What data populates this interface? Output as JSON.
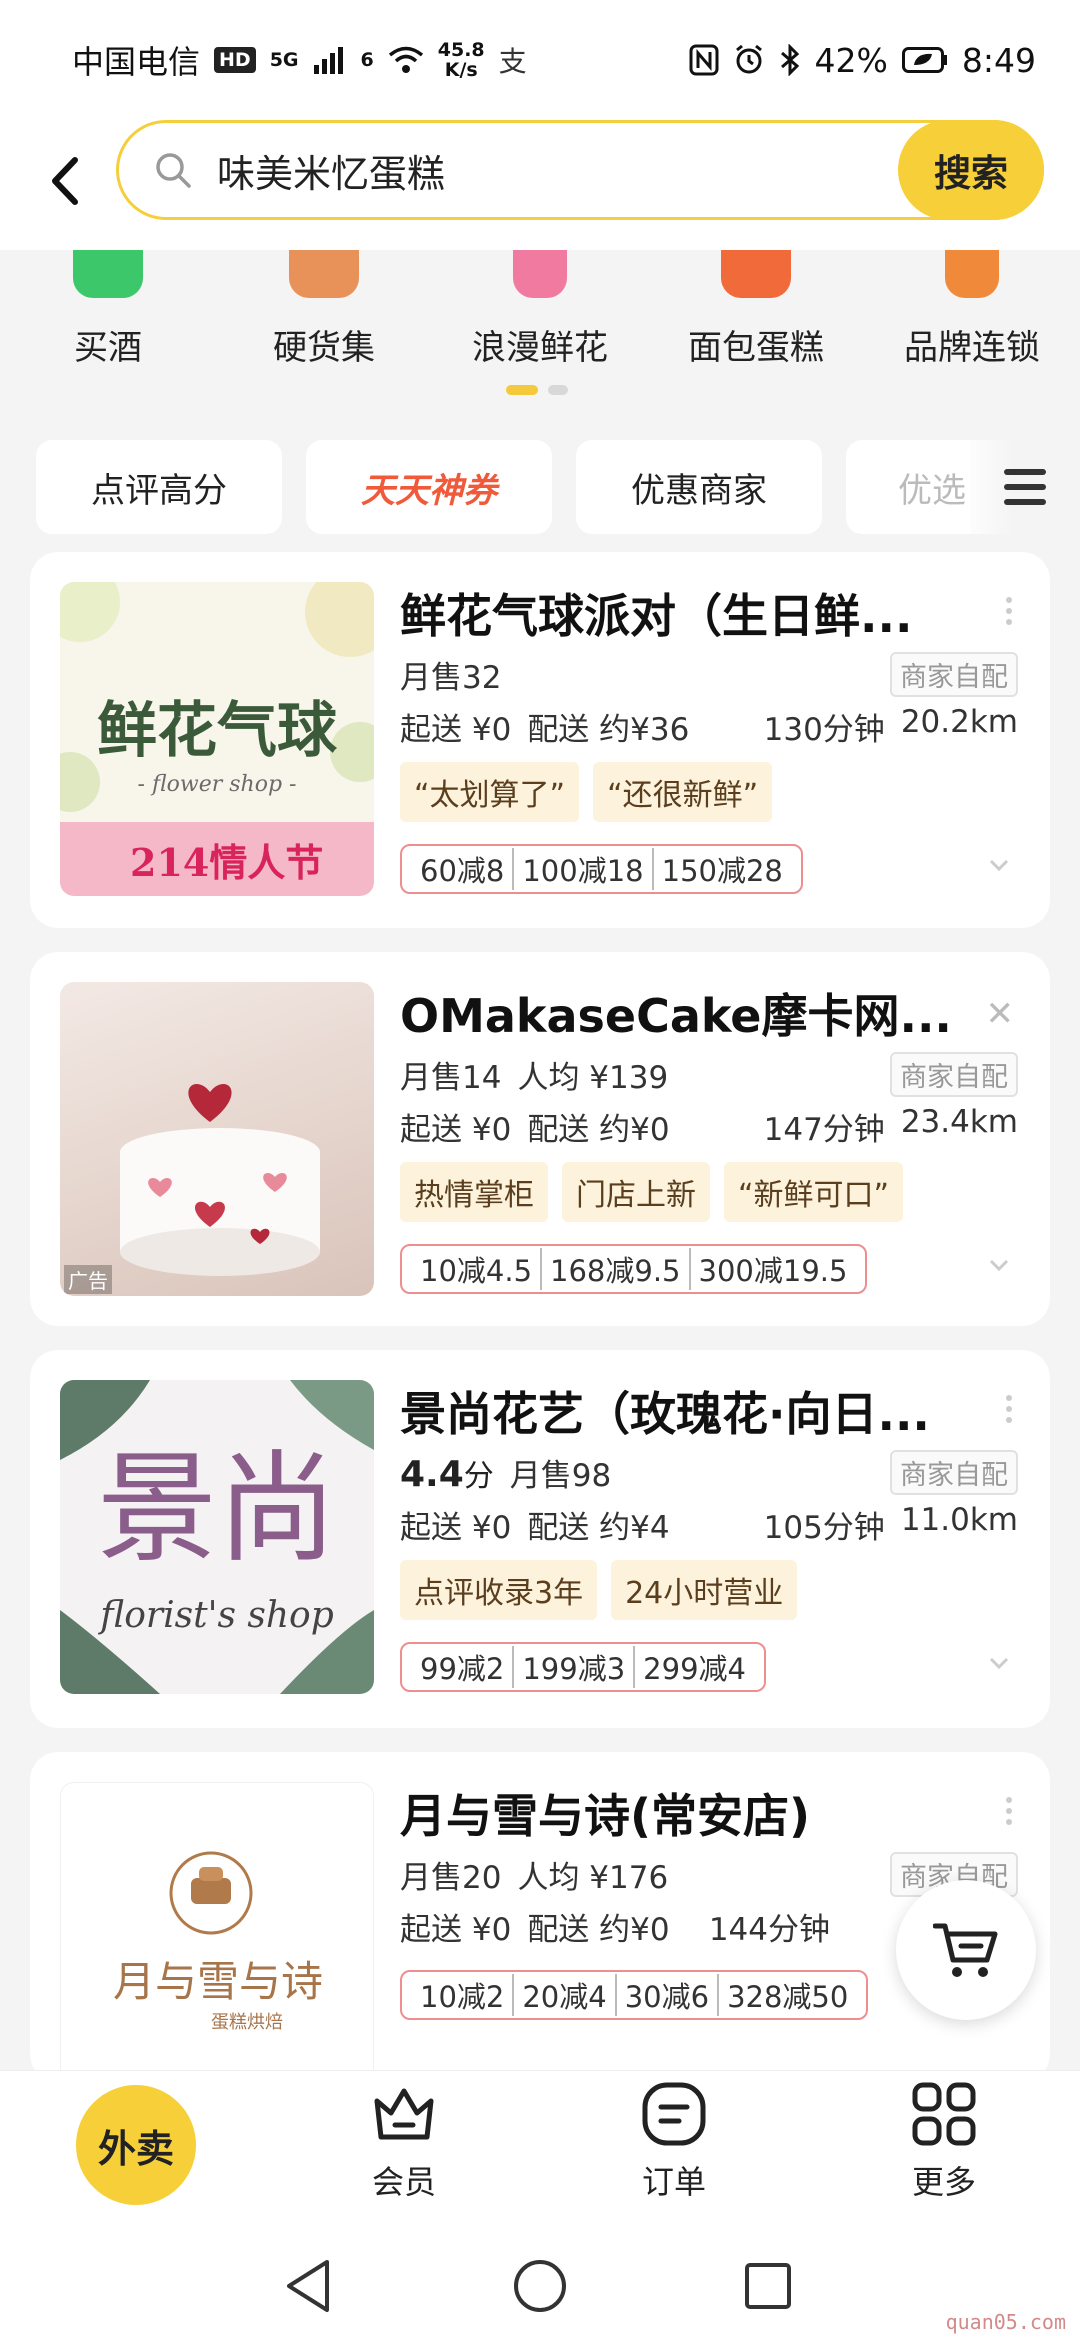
{
  "status_bar": {
    "carrier": "中国电信",
    "hd": "HD",
    "net_type": "5G",
    "wifi_sup": "6",
    "speed_value": "45.8",
    "speed_unit": "K/s",
    "pay_glyph": "支",
    "battery": "42%",
    "time": "8:49"
  },
  "search": {
    "query": "味美米忆蛋糕",
    "button_label": "搜索"
  },
  "categories": [
    {
      "label": "买酒",
      "color": "#3cc86a"
    },
    {
      "label": "硬货集",
      "color": "#e8925a"
    },
    {
      "label": "浪漫鲜花",
      "color": "#f07aa0"
    },
    {
      "label": "面包蛋糕",
      "color": "#f06a3a"
    },
    {
      "label": "品牌连锁",
      "color": "#f08a3a"
    }
  ],
  "filters": [
    "点评高分",
    "天天神券",
    "优惠商家",
    "优选"
  ],
  "stores": [
    {
      "name": "鲜花气球派对（生日鲜...",
      "thumb_title": "鲜花气球",
      "thumb_sub": "- flower shop -",
      "thumb_banner": "214情人节",
      "monthly_sales": "月售32",
      "per_capita": "",
      "rating": "",
      "rating_unit": "",
      "delivery_type": "商家自配",
      "min_order": "起送 ¥0",
      "delivery_fee": "配送 约¥36",
      "time": "130分钟",
      "distance": "20.2km",
      "tags": [
        "“太划算了”",
        "“还很新鲜”"
      ],
      "promos": [
        "60减8",
        "100减18",
        "150减28"
      ]
    },
    {
      "name": "OMakaseCake摩卡网...",
      "thumb_title": "",
      "ad_label": "广告",
      "monthly_sales": "月售14",
      "per_capita": "人均 ¥139",
      "rating": "",
      "rating_unit": "",
      "delivery_type": "商家自配",
      "min_order": "起送 ¥0",
      "delivery_fee": "配送 约¥0",
      "time": "147分钟",
      "distance": "23.4km",
      "tags": [
        "热情掌柜",
        "门店上新",
        "“新鲜可口”"
      ],
      "promos": [
        "10减4.5",
        "168减9.5",
        "300减19.5"
      ]
    },
    {
      "name": "景尚花艺（玫瑰花·向日...",
      "thumb_title": "景尚",
      "thumb_sub": "florist's shop",
      "monthly_sales": "月售98",
      "per_capita": "",
      "rating": "4.4",
      "rating_unit": "分",
      "delivery_type": "商家自配",
      "min_order": "起送 ¥0",
      "delivery_fee": "配送 约¥4",
      "time": "105分钟",
      "distance": "11.0km",
      "tags": [
        "点评收录3年",
        "24小时营业"
      ],
      "promos": [
        "99减2",
        "199减3",
        "299减4"
      ]
    },
    {
      "name": "月与雪与诗(常安店)",
      "thumb_title": "月与雪与诗",
      "thumb_sub": "蛋糕烘焙",
      "monthly_sales": "月售20",
      "per_capita": "人均 ¥176",
      "rating": "",
      "rating_unit": "",
      "delivery_type": "商家自配",
      "min_order": "起送 ¥0",
      "delivery_fee": "配送 约¥0",
      "time": "144分钟",
      "distance": "",
      "tags": [],
      "promos": [
        "10减2",
        "20减4",
        "30减6",
        "328减50"
      ]
    }
  ],
  "bottom_nav": {
    "home": "外卖",
    "member": "会员",
    "orders": "订单",
    "more": "更多"
  },
  "watermark": "quan05.com",
  "colors": {
    "accent": "#f7cf39",
    "promo_border": "#ef8e8e",
    "coupon_red": "#f05a3a"
  }
}
